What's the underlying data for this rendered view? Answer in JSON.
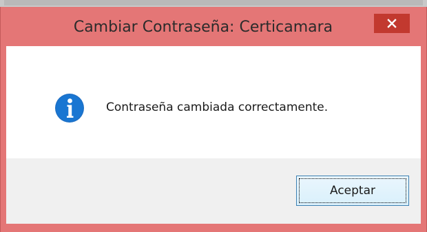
{
  "dialog": {
    "title": "Cambiar Contraseña: Certicamara",
    "message": "Contraseña cambiada correctamente.",
    "accept_label": "Aceptar",
    "close_glyph": "×"
  },
  "icons": {
    "status": "info-icon",
    "close": "close-icon"
  },
  "colors": {
    "frame": "#e47676",
    "close_button": "#c2392f",
    "info_icon": "#1e70c6",
    "button_border": "#3c7fb1"
  }
}
